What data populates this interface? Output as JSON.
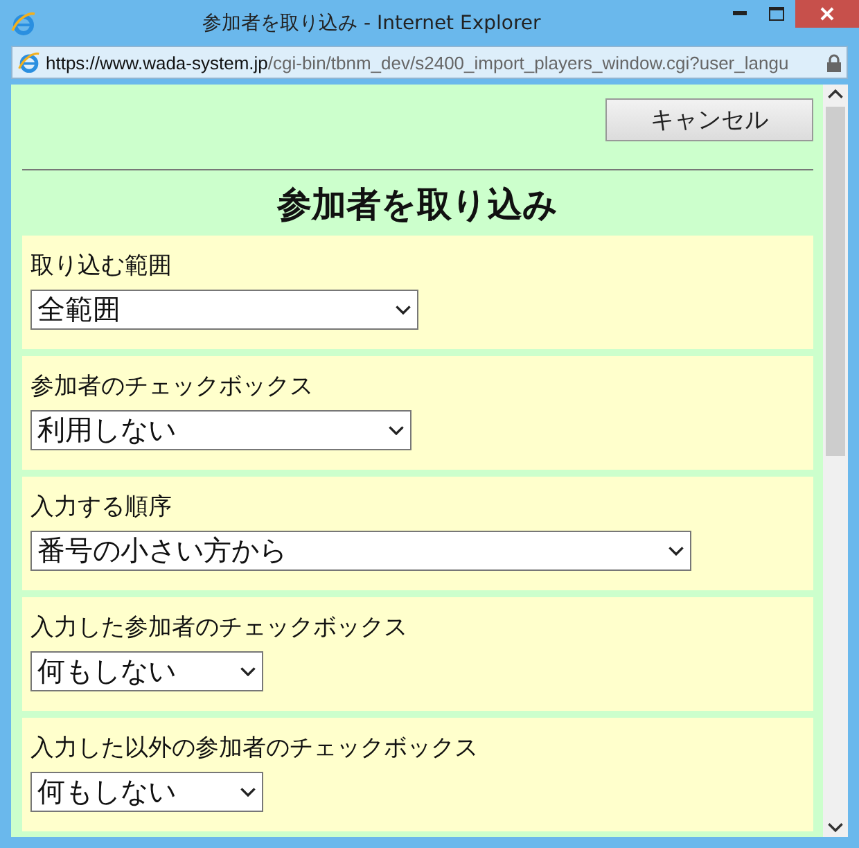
{
  "window": {
    "title": "参加者を取り込み - Internet Explorer"
  },
  "address_bar": {
    "host": "https://www.wada-system.jp",
    "path": "/cgi-bin/tbnm_dev/s2400_import_players_window.cgi?user_langu"
  },
  "cancel_button": "キャンセル",
  "heading": "参加者を取り込み",
  "sections": [
    {
      "label": "取り込む範囲",
      "value": "全範囲"
    },
    {
      "label": "参加者のチェックボックス",
      "value": "利用しない"
    },
    {
      "label": "入力する順序",
      "value": "番号の小さい方から"
    },
    {
      "label": "入力した参加者のチェックボックス",
      "value": "何もしない"
    },
    {
      "label": "入力した以外の参加者のチェックボックス",
      "value": "何もしない"
    }
  ]
}
